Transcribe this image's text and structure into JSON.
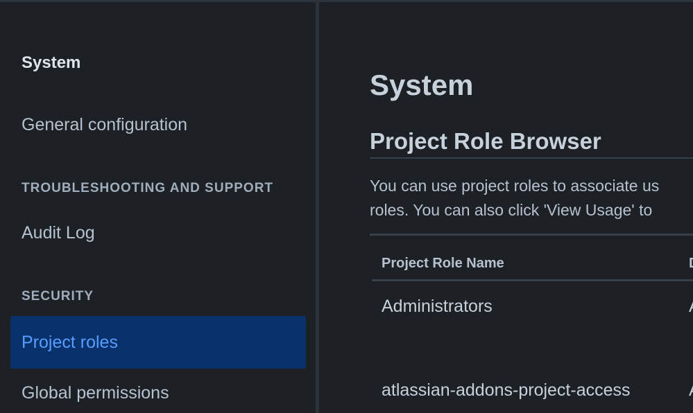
{
  "sidebar": {
    "title": "System",
    "general_configuration": "General configuration",
    "troubleshooting_section": "TROUBLESHOOTING AND SUPPORT",
    "audit_log": "Audit Log",
    "security_section": "SECURITY",
    "project_roles": "Project roles",
    "global_permissions": "Global permissions"
  },
  "main": {
    "page_title": "System",
    "section_title": "Project Role Browser",
    "description_line1": "You can use project roles to associate us",
    "description_line2": "roles. You can also click 'View Usage' to",
    "table": {
      "header_name": "Project Role Name",
      "header_next_clip": "D",
      "rows": [
        {
          "name": "Administrators",
          "next_clip": "A"
        },
        {
          "name": "atlassian-addons-project-access",
          "next_clip": "A"
        }
      ]
    }
  },
  "colors": {
    "background": "#1d2125",
    "selected_bg": "#09326c",
    "selected_text": "#579dff"
  }
}
